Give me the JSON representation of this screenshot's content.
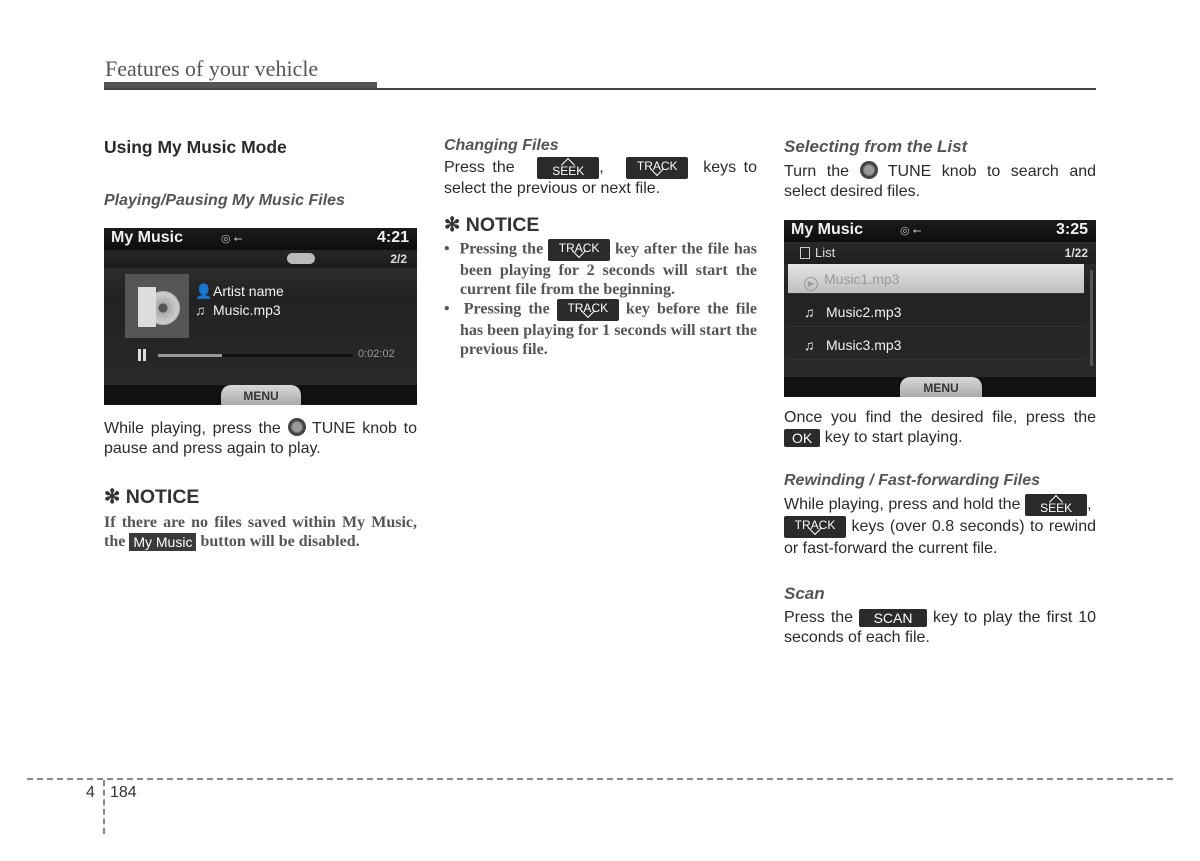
{
  "header": {
    "title": "Features of your vehicle"
  },
  "col1": {
    "section_title": "Using My Music Mode",
    "sub_title": "Playing/Pausing My Music Files",
    "screen": {
      "title": "My Music",
      "source_icons": "◎ ⭠",
      "time": "4:21",
      "count": "2/2",
      "artist": "Artist name",
      "file": "Music.mp3",
      "progress_fraction": 0.33,
      "elapsed": "0:02:02",
      "menu_label": "MENU"
    },
    "body_1a": "While playing, press the",
    "body_1b": "TUNE knob to pause and press again to play.",
    "notice_title": "✻ NOTICE",
    "notice_a": "If there are no files saved within My Music, the",
    "notice_key": "My Music",
    "notice_b": "button will be disabled."
  },
  "col2": {
    "sub_title": "Changing Files",
    "body_a": "Press the",
    "body_sep": ",",
    "body_b": "keys to select the previous or next file.",
    "notice_title": "✻ NOTICE",
    "bullets": [
      {
        "a": "Pressing the",
        "b": "key after the file has been playing for 2 seconds will start the current file from the beginning."
      },
      {
        "a": "Pressing the",
        "b": "key before the file has been playing for 1 seconds will start the previous file."
      }
    ]
  },
  "keys": {
    "seek": "SEEK",
    "track": "TRACK",
    "ok": "OK",
    "scan": "SCAN"
  },
  "col3": {
    "sub_title_1": "Selecting from the List",
    "body_1a": "Turn the",
    "body_1b": "TUNE knob to search and select desired files.",
    "screen": {
      "title": "My Music",
      "time": "3:25",
      "list_label": "List",
      "count": "1/22",
      "items": [
        "Music1.mp3",
        "Music2.mp3",
        "Music3.mp3"
      ],
      "menu_label": "MENU"
    },
    "body_2a": "Once you find the desired file, press the",
    "body_2b": "key to start playing.",
    "sub_title_2": "Rewinding / Fast-forwarding Files",
    "body_3a": "While playing, press and hold the",
    "body_3sep": ",",
    "body_3b": "keys (over 0.8 seconds) to rewind or fast-forward the current file.",
    "sub_title_3": "Scan",
    "body_4a": "Press the",
    "body_4b": "key to play the first 10 seconds of each file."
  },
  "footer": {
    "chapter": "4",
    "page": "184"
  }
}
